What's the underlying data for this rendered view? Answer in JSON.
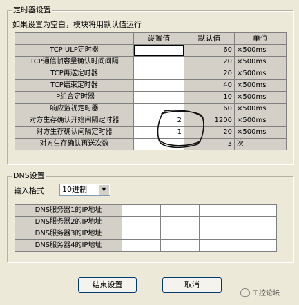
{
  "timer_group": {
    "title": "定时器设置",
    "note": "如果设置为空白，模块将用默认值运行",
    "headers": [
      "",
      "设置值",
      "默认值",
      "单位"
    ],
    "rows": [
      {
        "label": "TCP ULP定时器",
        "setting": "",
        "default": "60",
        "unit": "×500ms"
      },
      {
        "label": "TCP通信帧容量确认时间间隔",
        "setting": "",
        "default": "20",
        "unit": "×500ms"
      },
      {
        "label": "TCP再送定时器",
        "setting": "",
        "default": "20",
        "unit": "×500ms"
      },
      {
        "label": "TCP结束定时器",
        "setting": "",
        "default": "40",
        "unit": "×500ms"
      },
      {
        "label": "IP组合定时器",
        "setting": "",
        "default": "10",
        "unit": "×500ms"
      },
      {
        "label": "响应监视定时器",
        "setting": "",
        "default": "60",
        "unit": "×500ms"
      },
      {
        "label": "对方生存确认开始间隔定时器",
        "setting": "2",
        "default": "1200",
        "unit": "×500ms"
      },
      {
        "label": "对方生存确认间隔定时器",
        "setting": "1",
        "default": "20",
        "unit": "×500ms"
      },
      {
        "label": "对方生存确认再送次数",
        "setting": "",
        "default": "3",
        "unit": "次"
      }
    ]
  },
  "dns_group": {
    "title": "DNS设置",
    "format_label": "输入格式",
    "format_value": "10进制",
    "servers": [
      {
        "label": "DNS服务器1的IP地址",
        "octets": [
          "",
          "",
          "",
          ""
        ]
      },
      {
        "label": "DNS服务器2的IP地址",
        "octets": [
          "",
          "",
          "",
          ""
        ]
      },
      {
        "label": "DNS服务器3的IP地址",
        "octets": [
          "",
          "",
          "",
          ""
        ]
      },
      {
        "label": "DNS服务器4的IP地址",
        "octets": [
          "",
          "",
          "",
          ""
        ]
      }
    ]
  },
  "buttons": {
    "ok": "结束设置",
    "cancel": "取消"
  },
  "watermark": "工控论坛"
}
